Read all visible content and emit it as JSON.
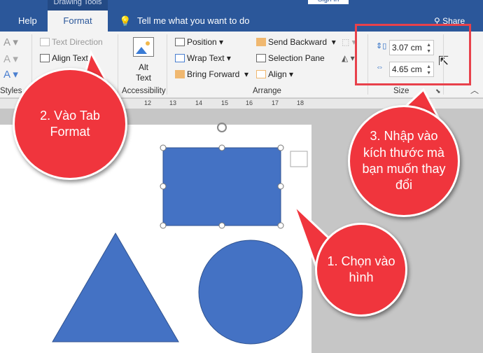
{
  "titlebar": {
    "context_tab": "Drawing Tools",
    "sign_in": "Sign in"
  },
  "tabs": {
    "help": "Help",
    "format": "Format",
    "tell_me": "Tell me what you want to do",
    "share": "Share"
  },
  "ribbon": {
    "text_direction": "Text Direction",
    "align_text": "Align Text",
    "styles_group": "Styles",
    "alt_text": "Alt Text",
    "accessibility_group": "Accessibility",
    "position": "Position",
    "wrap_text": "Wrap Text",
    "bring_forward": "Bring Forward",
    "send_backward": "Send Backward",
    "selection_pane": "Selection Pane",
    "align": "Align",
    "arrange_group": "Arrange",
    "height_value": "3.07 cm",
    "width_value": "4.65 cm",
    "size_group": "Size"
  },
  "ruler": {
    "ticks": [
      "12",
      "13",
      "14",
      "15",
      "16",
      "17",
      "18"
    ]
  },
  "callouts": {
    "step1": "1. Chọn vào hình",
    "step2": "2. Vào Tab Format",
    "step3": "3. Nhập vào kích thước mà bạn muốn thay đổi"
  },
  "colors": {
    "accent": "#2b579a",
    "shape_fill": "#4472c4",
    "callout": "#f0353d",
    "highlight_box": "#e8414b"
  }
}
